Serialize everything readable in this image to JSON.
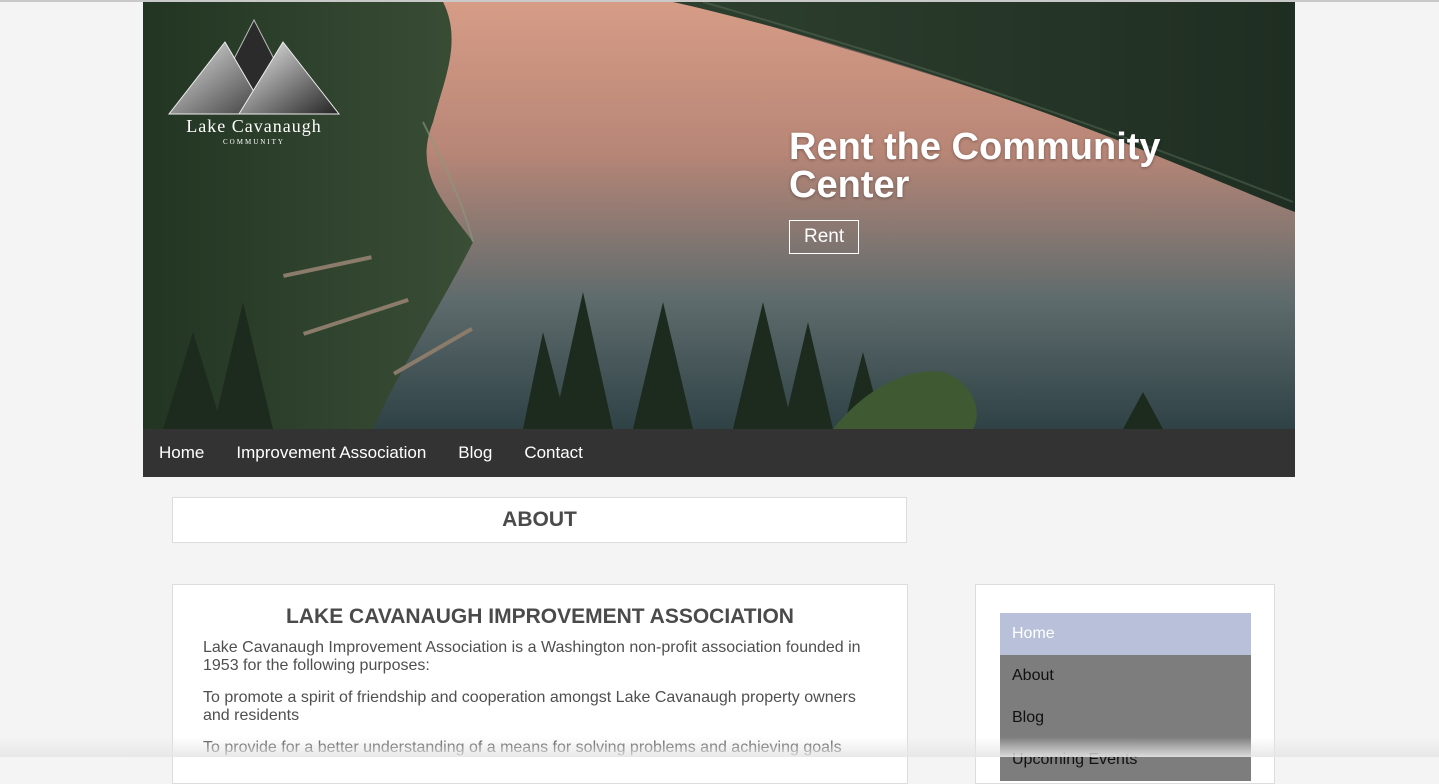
{
  "logo": {
    "name": "Lake Cavanaugh",
    "sub": "COMMUNITY"
  },
  "hero": {
    "title_line1": "Rent the Community",
    "title_line2": "Center",
    "button_label": "Rent"
  },
  "nav": {
    "items": [
      "Home",
      "Improvement Association",
      "Blog",
      "Contact"
    ]
  },
  "about": {
    "heading": "ABOUT"
  },
  "article": {
    "heading": "LAKE CAVANAUGH IMPROVEMENT ASSOCIATION",
    "paragraphs": [
      "Lake Cavanaugh Improvement Association is a Washington non-profit association founded in 1953 for the following purposes:",
      "To promote a spirit of friendship and cooperation amongst Lake Cavanaugh property owners and residents",
      "To provide for a better understanding of a means for solving problems and achieving goals"
    ]
  },
  "sidebar": {
    "items": [
      "Home",
      "About",
      "Blog",
      "Upcoming Events"
    ],
    "active_index": 0
  },
  "colors": {
    "nav_bg": "#333333",
    "page_bg": "#f4f4f4",
    "sidebar_active": "#b8c1d9",
    "sidebar_bg": "#7d7d7d"
  }
}
